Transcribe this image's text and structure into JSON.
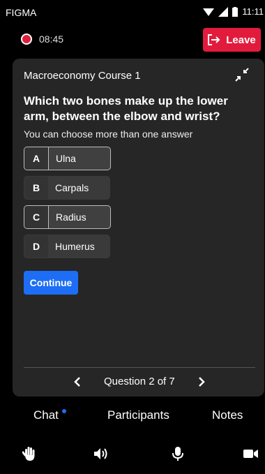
{
  "status": {
    "app": "FIGMA",
    "time": "11:11"
  },
  "session": {
    "recording_time": "08:45",
    "leave_label": "Leave"
  },
  "card": {
    "course": "Macroeconomy Course 1",
    "question": "Which two bones make up the lower arm, between the elbow and wrist?",
    "hint": "You can choose more than one answer",
    "options": [
      {
        "letter": "A",
        "text": "Ulna",
        "selected": true
      },
      {
        "letter": "B",
        "text": "Carpals",
        "selected": false
      },
      {
        "letter": "C",
        "text": "Radius",
        "selected": true
      },
      {
        "letter": "D",
        "text": "Humerus",
        "selected": false
      }
    ],
    "continue_label": "Continue",
    "pager_label": "Question 2 of 7"
  },
  "tabs": {
    "chat": "Chat",
    "participants": "Participants",
    "notes": "Notes"
  },
  "icons": {
    "collapse": "collapse-icon",
    "prev": "chevron-left-icon",
    "next": "chevron-right-icon",
    "raise_hand": "hand-icon",
    "speaker": "speaker-icon",
    "mic": "mic-icon",
    "video": "video-icon"
  },
  "colors": {
    "leave": "#e21b3c",
    "accent": "#1d6ef5",
    "card": "#262626"
  }
}
